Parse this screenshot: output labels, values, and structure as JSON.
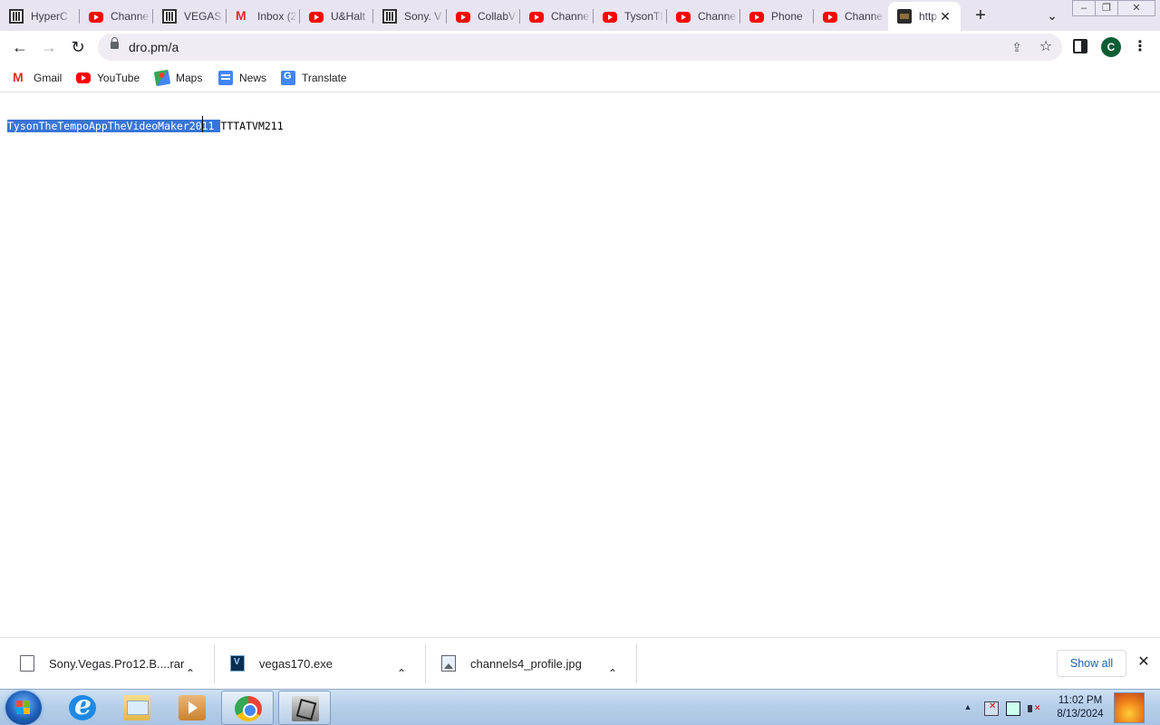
{
  "browser": {
    "tabs": [
      {
        "title": "HyperC",
        "favicon": "bars-icon"
      },
      {
        "title": "Channe",
        "favicon": "youtube-icon"
      },
      {
        "title": "VEGAS",
        "favicon": "bars-icon"
      },
      {
        "title": "Inbox (2",
        "favicon": "gmail-icon"
      },
      {
        "title": "U&Halt",
        "favicon": "youtube-icon"
      },
      {
        "title": "Sony. V",
        "favicon": "bars-icon"
      },
      {
        "title": "CollabV",
        "favicon": "youtube-icon"
      },
      {
        "title": "Channe",
        "favicon": "youtube-icon"
      },
      {
        "title": "TysonTI",
        "favicon": "youtube-icon"
      },
      {
        "title": "Channe",
        "favicon": "youtube-icon"
      },
      {
        "title": "Phone",
        "favicon": "youtube-icon"
      },
      {
        "title": "Channe",
        "favicon": "youtube-icon"
      },
      {
        "title": "http",
        "favicon": "page-icon",
        "active": true
      }
    ],
    "new_tab_symbol": "+",
    "close_symbol": "✕",
    "tab_search_symbol": "⌄",
    "window_controls": {
      "minimize": "–",
      "maximize": "❐",
      "close": "✕"
    },
    "toolbar": {
      "back": "←",
      "forward": "→",
      "reload": "↻",
      "url": "dro.pm/a",
      "share": "⇪",
      "star": "☆",
      "profile_initial": "C",
      "menu": "⋮"
    },
    "bookmarks": [
      {
        "label": "Gmail",
        "icon": "gmail-icon"
      },
      {
        "label": "YouTube",
        "icon": "youtube-icon"
      },
      {
        "label": "Maps",
        "icon": "maps-icon"
      },
      {
        "label": "News",
        "icon": "news-icon"
      },
      {
        "label": "Translate",
        "icon": "translate-icon"
      }
    ]
  },
  "page": {
    "selected_text": "TysonTheTempoAppTheVideoMaker2011 ",
    "rest_text": "TTTATVM211"
  },
  "downloads": {
    "items": [
      {
        "name": "Sony.Vegas.Pro12.B....rar",
        "icon": "file-icon"
      },
      {
        "name": "vegas170.exe",
        "icon": "vegas-icon"
      },
      {
        "name": "channels4_profile.jpg",
        "icon": "image-icon"
      }
    ],
    "caret": "⌃",
    "show_all": "Show all",
    "close": "✕"
  },
  "taskbar": {
    "clock_time": "11:02 PM",
    "clock_date": "8/13/2024",
    "tray_arrow": "▲"
  },
  "colors": {
    "selection": "#3875d7",
    "tabstrip": "#e8e4f0",
    "avatar": "#0b5d34"
  }
}
